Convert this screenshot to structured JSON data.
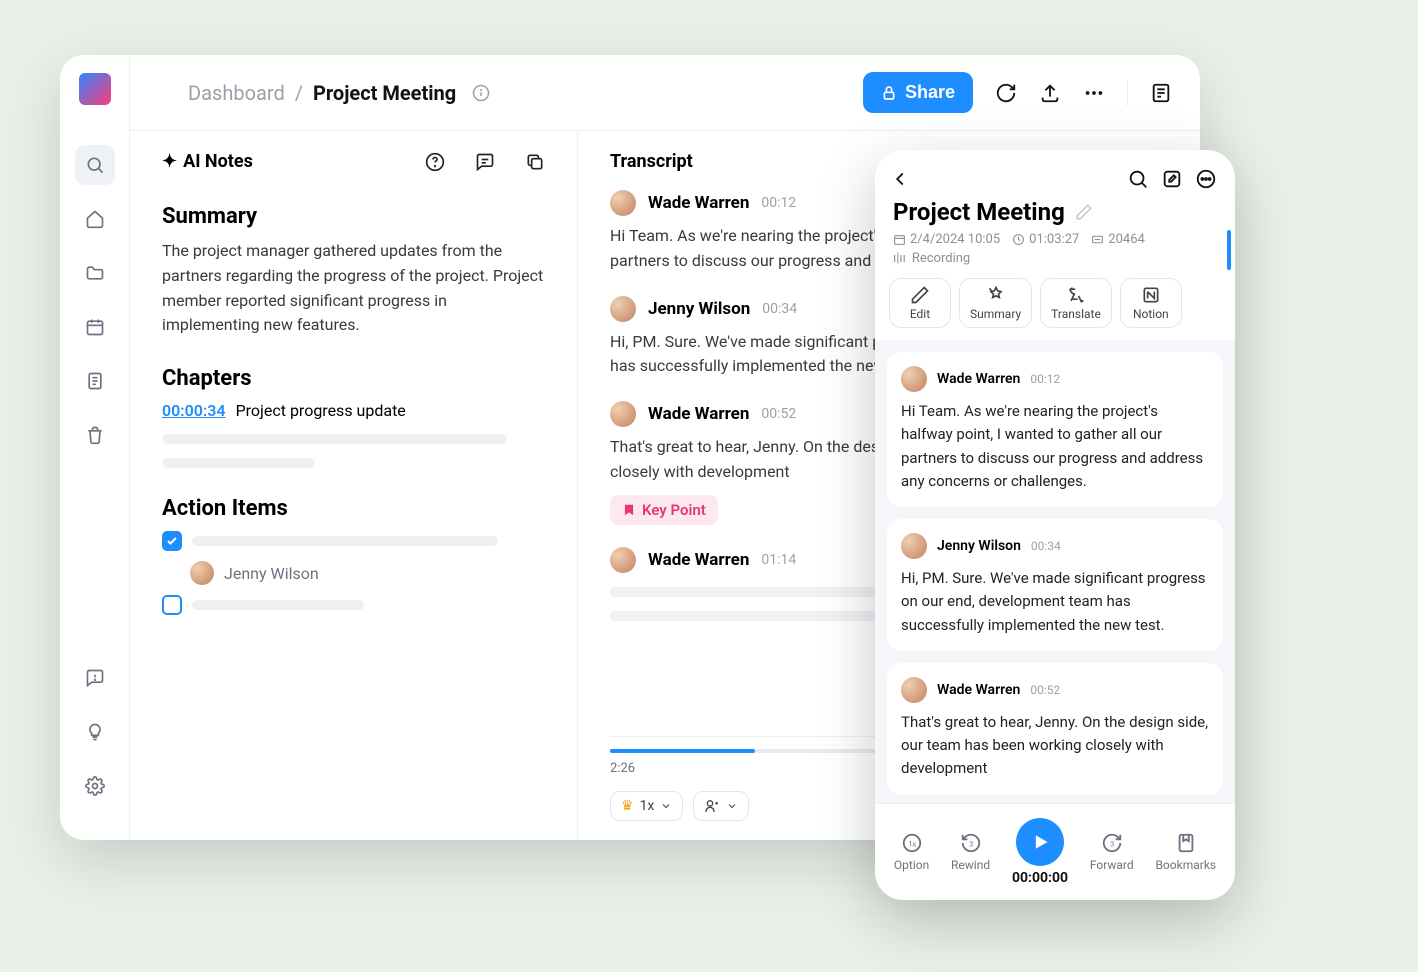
{
  "breadcrumb": {
    "root": "Dashboard",
    "sep": "/",
    "current": "Project Meeting"
  },
  "share_label": "Share",
  "notes": {
    "header": "AI Notes",
    "summary_title": "Summary",
    "summary_text": "The project manager gathered updates from the partners regarding the progress of the project. Project member reported significant progress in implementing new features.",
    "chapters_title": "Chapters",
    "chapter_time": "00:00:34",
    "chapter_label": "Project progress update",
    "action_title": "Action Items",
    "assignee": "Jenny Wilson"
  },
  "transcript": {
    "title": "Transcript",
    "entries": [
      {
        "speaker": "Wade Warren",
        "time": "00:12",
        "text": "Hi Team. As we're nearing the project's halfway point, I wanted to gather all our partners to discuss our progress and address any concerns or challenges."
      },
      {
        "speaker": "Jenny Wilson",
        "time": "00:34",
        "text": "Hi, PM. Sure. We've made significant progress on our end, development team has successfully implemented the new test."
      },
      {
        "speaker": "Wade Warren",
        "time": "00:52",
        "text": "That's great to hear, Jenny. On the design side, our team has been working closely with development"
      },
      {
        "speaker": "Wade Warren",
        "time": "01:14",
        "text": ""
      }
    ],
    "keypoint": "Key Point",
    "position": "2:26",
    "speed": "1x"
  },
  "mobile": {
    "title": "Project Meeting",
    "date": "2/4/2024 10:05",
    "duration": "01:03:27",
    "words": "20464",
    "recording": "Recording",
    "actions": {
      "edit": "Edit",
      "summary": "Summary",
      "translate": "Translate",
      "notion": "Notion"
    },
    "entries": [
      {
        "speaker": "Wade Warren",
        "time": "00:12",
        "text": "Hi Team. As we're nearing the project's halfway point, I wanted to gather all our partners to discuss our progress and address any concerns or challenges."
      },
      {
        "speaker": "Jenny Wilson",
        "time": "00:34",
        "text": "Hi, PM. Sure. We've made significant progress on our end, development team has successfully implemented the new test."
      },
      {
        "speaker": "Wade Warren",
        "time": "00:52",
        "text": "That's great to hear, Jenny. On the design side, our team has been working closely with development"
      }
    ],
    "player": {
      "option": "Option",
      "rewind": "Rewind",
      "time": "00:00:00",
      "forward": "Forward",
      "bookmarks": "Bookmarks"
    }
  }
}
